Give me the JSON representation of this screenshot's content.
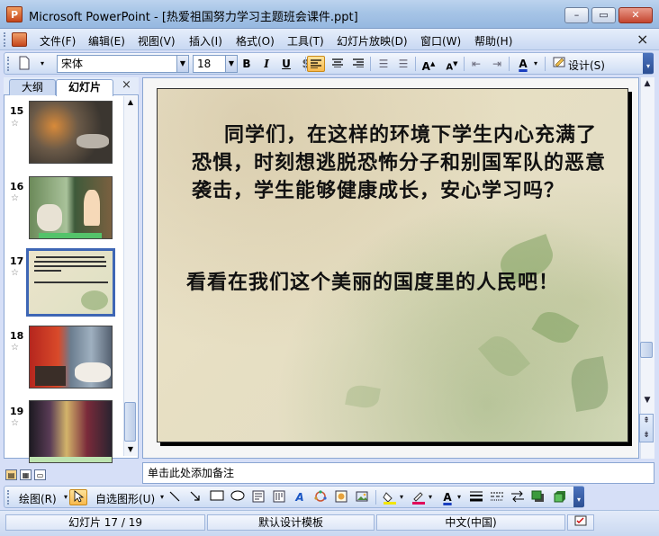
{
  "window": {
    "app_logo": "P",
    "title": "Microsoft PowerPoint - [热爱祖国努力学习主题班会课件.ppt]",
    "controls": {
      "minimize": "–",
      "restore": "▭",
      "close": "✕"
    }
  },
  "menu": {
    "items": [
      "文件(F)",
      "编辑(E)",
      "视图(V)",
      "插入(I)",
      "格式(O)",
      "工具(T)",
      "幻灯片放映(D)",
      "窗口(W)",
      "帮助(H)"
    ],
    "close_doc": "×"
  },
  "toolbar": {
    "font_name": "宋体",
    "font_size": "18",
    "bold": "B",
    "italic": "I",
    "underline": "U",
    "shadow": "S",
    "design_label": "设计(S)"
  },
  "left_pane": {
    "tabs": [
      "大纲",
      "幻灯片"
    ],
    "close": "×",
    "slides": [
      {
        "number": "15"
      },
      {
        "number": "16"
      },
      {
        "number": "17",
        "selected": true
      },
      {
        "number": "18"
      },
      {
        "number": "19"
      }
    ]
  },
  "slide": {
    "paragraph": "同学们，在这样的环境下学生内心充满了恐惧，时刻想逃脱恐怖分子和别国军队的恶意袭击，学生能够健康成长，安心学习吗？",
    "line2": "看看在我们这个美丽的国度里的人民吧！"
  },
  "notes": {
    "placeholder": "单击此处添加备注"
  },
  "drawing_toolbar": {
    "draw_label": "绘图(R)",
    "autoshapes_label": "自选图形(U)"
  },
  "status": {
    "slide_position": "幻灯片 17 / 19",
    "design_template": "默认设计模板",
    "language": "中文(中国)"
  },
  "colors": {
    "title_bar": "#a6c4e6",
    "toolbar": "#cddcf4",
    "selection_border": "#3e66b5"
  }
}
